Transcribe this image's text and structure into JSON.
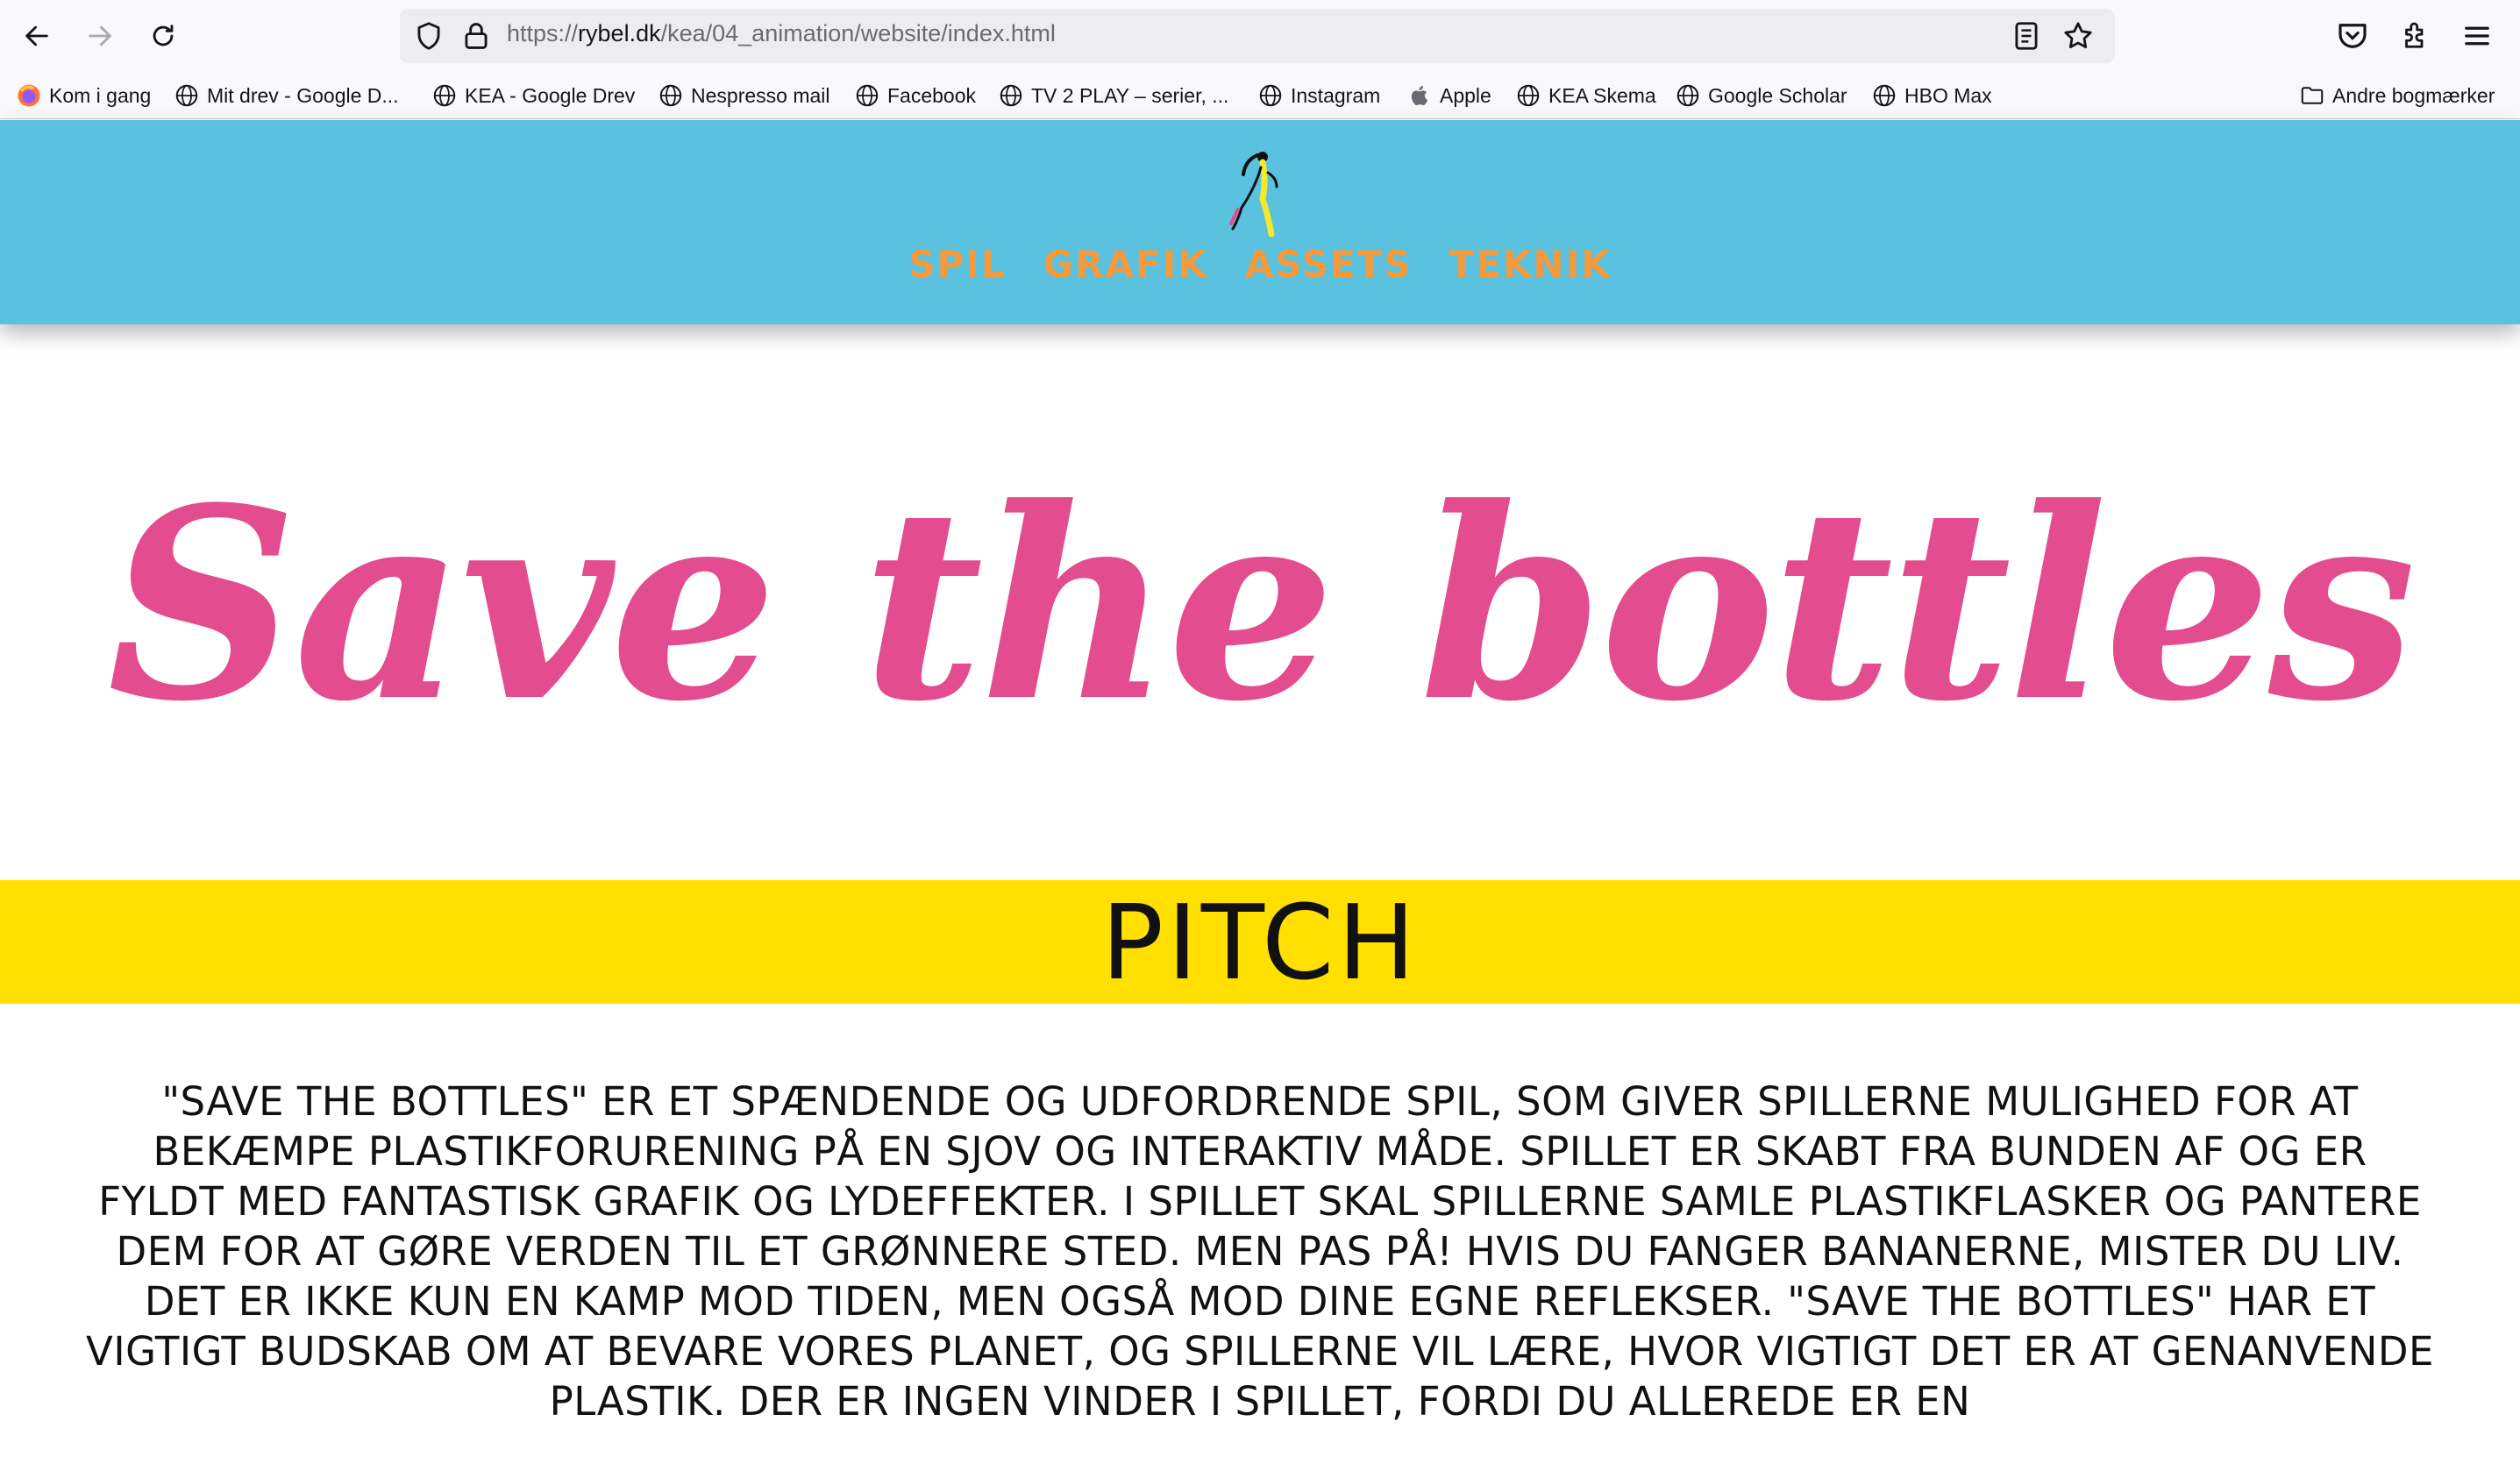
{
  "browser": {
    "url_prefix": "https://",
    "url_host": "rybel.dk",
    "url_path": "/kea/04_animation/website/index.html",
    "bookmarks": [
      {
        "label": "Kom i gang",
        "icon": "firefox-icon"
      },
      {
        "label": "Mit drev - Google D...",
        "icon": "globe-icon"
      },
      {
        "label": "KEA - Google Drev",
        "icon": "globe-icon"
      },
      {
        "label": "Nespresso mail",
        "icon": "globe-icon"
      },
      {
        "label": "Facebook",
        "icon": "globe-icon"
      },
      {
        "label": "TV 2 PLAY – serier, ...",
        "icon": "globe-icon"
      },
      {
        "label": "Instagram",
        "icon": "globe-icon"
      },
      {
        "label": "Apple",
        "icon": "apple-icon"
      },
      {
        "label": "KEA Skema",
        "icon": "globe-icon"
      },
      {
        "label": "Google Scholar",
        "icon": "globe-icon"
      },
      {
        "label": "HBO Max",
        "icon": "globe-icon"
      }
    ],
    "other_bookmarks": "Andre bogmærker"
  },
  "site": {
    "nav": [
      "SPIL",
      "GRAFIK",
      "ASSETS",
      "TEKNIK"
    ],
    "title": "Save the bottles",
    "section_heading": "PITCH",
    "pitch": "\"Save the bottles\" er et spændende og udfordrende spil, som giver spillerne mulighed for at bekæmpe plastikforurening på en sjov og interaktiv måde. Spillet er skabt fra bunden af og er fyldt med fantastisk grafik og lydeffekter. I spillet skal spillerne samle plastikflasker og pantere dem for at gøre verden til et grønnere sted. Men pas på! Hvis du fanger bananerne, mister du liv. Det er ikke kun en kamp mod tiden, men også mod dine egne reflekser. \"Save the bottles\" har et vigtigt budskab om at bevare vores planet, og spillerne vil lære, hvor vigtigt det er at genanvende plastik. Der er ingen vinder i spillet, fordi du allerede er en"
  },
  "colors": {
    "header_bg": "#5ac1de",
    "nav_text": "#f29a3d",
    "title": "#e34d8f",
    "pitch_band": "#ffe000"
  }
}
